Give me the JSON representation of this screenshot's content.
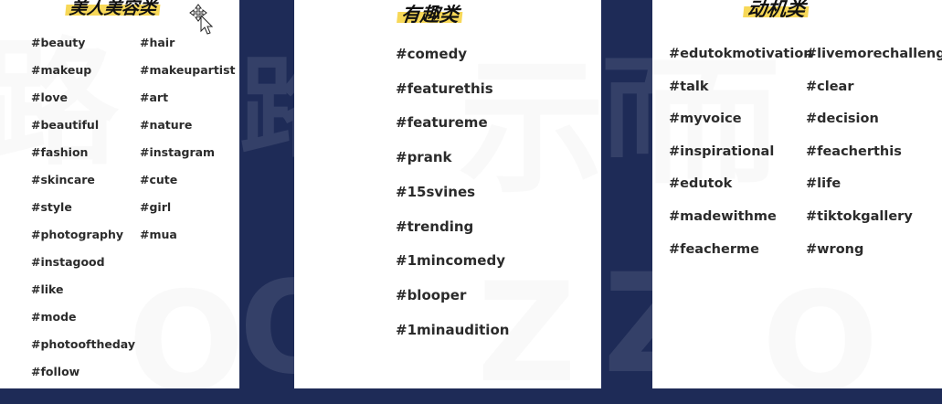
{
  "panels": [
    {
      "title": "美人美容类",
      "columns": [
        [
          "#beauty",
          "#makeup",
          "#love",
          "#beautiful",
          "#fashion",
          "#skincare",
          "#style",
          "#photography",
          "#instagood",
          "#like",
          "#mode",
          "#photooftheday",
          "#follow"
        ],
        [
          "#hair",
          "#makeupartist",
          "#art",
          "#nature",
          "#instagram",
          "#cute",
          "#girl",
          "#mua"
        ]
      ]
    },
    {
      "title": "有趣类",
      "columns": [
        [
          "#comedy",
          "#featurethis",
          "#featureme",
          "#prank",
          "#15svines",
          "#trending",
          "#1mincomedy",
          "#blooper",
          "#1minaudition"
        ]
      ]
    },
    {
      "title": "动机类",
      "columns": [
        [
          "#edutokmotivation",
          "#talk",
          "#myvoice",
          "#inspirational",
          "#edutok",
          "#madewithme",
          "#feacherme"
        ],
        [
          "#livemorechallenge",
          "#clear",
          "#decision",
          "#feacherthis",
          "#life",
          "#tiktokgallery",
          "#wrong"
        ]
      ]
    }
  ],
  "colors": {
    "background": "#1e2b57",
    "panel": "#ffffff",
    "title_highlight": "#f7d858",
    "tag_text": "#2b2b2b"
  },
  "icons": {
    "cursor": "move-cursor-icon"
  }
}
